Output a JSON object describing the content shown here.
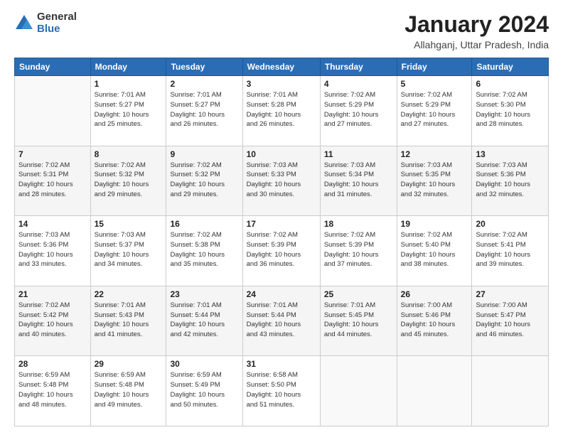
{
  "logo": {
    "general": "General",
    "blue": "Blue"
  },
  "header": {
    "title": "January 2024",
    "subtitle": "Allahganj, Uttar Pradesh, India"
  },
  "days_of_week": [
    "Sunday",
    "Monday",
    "Tuesday",
    "Wednesday",
    "Thursday",
    "Friday",
    "Saturday"
  ],
  "weeks": [
    [
      {
        "day": "",
        "info": ""
      },
      {
        "day": "1",
        "info": "Sunrise: 7:01 AM\nSunset: 5:27 PM\nDaylight: 10 hours\nand 25 minutes."
      },
      {
        "day": "2",
        "info": "Sunrise: 7:01 AM\nSunset: 5:27 PM\nDaylight: 10 hours\nand 26 minutes."
      },
      {
        "day": "3",
        "info": "Sunrise: 7:01 AM\nSunset: 5:28 PM\nDaylight: 10 hours\nand 26 minutes."
      },
      {
        "day": "4",
        "info": "Sunrise: 7:02 AM\nSunset: 5:29 PM\nDaylight: 10 hours\nand 27 minutes."
      },
      {
        "day": "5",
        "info": "Sunrise: 7:02 AM\nSunset: 5:29 PM\nDaylight: 10 hours\nand 27 minutes."
      },
      {
        "day": "6",
        "info": "Sunrise: 7:02 AM\nSunset: 5:30 PM\nDaylight: 10 hours\nand 28 minutes."
      }
    ],
    [
      {
        "day": "7",
        "info": "Sunrise: 7:02 AM\nSunset: 5:31 PM\nDaylight: 10 hours\nand 28 minutes."
      },
      {
        "day": "8",
        "info": "Sunrise: 7:02 AM\nSunset: 5:32 PM\nDaylight: 10 hours\nand 29 minutes."
      },
      {
        "day": "9",
        "info": "Sunrise: 7:02 AM\nSunset: 5:32 PM\nDaylight: 10 hours\nand 29 minutes."
      },
      {
        "day": "10",
        "info": "Sunrise: 7:03 AM\nSunset: 5:33 PM\nDaylight: 10 hours\nand 30 minutes."
      },
      {
        "day": "11",
        "info": "Sunrise: 7:03 AM\nSunset: 5:34 PM\nDaylight: 10 hours\nand 31 minutes."
      },
      {
        "day": "12",
        "info": "Sunrise: 7:03 AM\nSunset: 5:35 PM\nDaylight: 10 hours\nand 32 minutes."
      },
      {
        "day": "13",
        "info": "Sunrise: 7:03 AM\nSunset: 5:36 PM\nDaylight: 10 hours\nand 32 minutes."
      }
    ],
    [
      {
        "day": "14",
        "info": "Sunrise: 7:03 AM\nSunset: 5:36 PM\nDaylight: 10 hours\nand 33 minutes."
      },
      {
        "day": "15",
        "info": "Sunrise: 7:03 AM\nSunset: 5:37 PM\nDaylight: 10 hours\nand 34 minutes."
      },
      {
        "day": "16",
        "info": "Sunrise: 7:02 AM\nSunset: 5:38 PM\nDaylight: 10 hours\nand 35 minutes."
      },
      {
        "day": "17",
        "info": "Sunrise: 7:02 AM\nSunset: 5:39 PM\nDaylight: 10 hours\nand 36 minutes."
      },
      {
        "day": "18",
        "info": "Sunrise: 7:02 AM\nSunset: 5:39 PM\nDaylight: 10 hours\nand 37 minutes."
      },
      {
        "day": "19",
        "info": "Sunrise: 7:02 AM\nSunset: 5:40 PM\nDaylight: 10 hours\nand 38 minutes."
      },
      {
        "day": "20",
        "info": "Sunrise: 7:02 AM\nSunset: 5:41 PM\nDaylight: 10 hours\nand 39 minutes."
      }
    ],
    [
      {
        "day": "21",
        "info": "Sunrise: 7:02 AM\nSunset: 5:42 PM\nDaylight: 10 hours\nand 40 minutes."
      },
      {
        "day": "22",
        "info": "Sunrise: 7:01 AM\nSunset: 5:43 PM\nDaylight: 10 hours\nand 41 minutes."
      },
      {
        "day": "23",
        "info": "Sunrise: 7:01 AM\nSunset: 5:44 PM\nDaylight: 10 hours\nand 42 minutes."
      },
      {
        "day": "24",
        "info": "Sunrise: 7:01 AM\nSunset: 5:44 PM\nDaylight: 10 hours\nand 43 minutes."
      },
      {
        "day": "25",
        "info": "Sunrise: 7:01 AM\nSunset: 5:45 PM\nDaylight: 10 hours\nand 44 minutes."
      },
      {
        "day": "26",
        "info": "Sunrise: 7:00 AM\nSunset: 5:46 PM\nDaylight: 10 hours\nand 45 minutes."
      },
      {
        "day": "27",
        "info": "Sunrise: 7:00 AM\nSunset: 5:47 PM\nDaylight: 10 hours\nand 46 minutes."
      }
    ],
    [
      {
        "day": "28",
        "info": "Sunrise: 6:59 AM\nSunset: 5:48 PM\nDaylight: 10 hours\nand 48 minutes."
      },
      {
        "day": "29",
        "info": "Sunrise: 6:59 AM\nSunset: 5:48 PM\nDaylight: 10 hours\nand 49 minutes."
      },
      {
        "day": "30",
        "info": "Sunrise: 6:59 AM\nSunset: 5:49 PM\nDaylight: 10 hours\nand 50 minutes."
      },
      {
        "day": "31",
        "info": "Sunrise: 6:58 AM\nSunset: 5:50 PM\nDaylight: 10 hours\nand 51 minutes."
      },
      {
        "day": "",
        "info": ""
      },
      {
        "day": "",
        "info": ""
      },
      {
        "day": "",
        "info": ""
      }
    ]
  ]
}
